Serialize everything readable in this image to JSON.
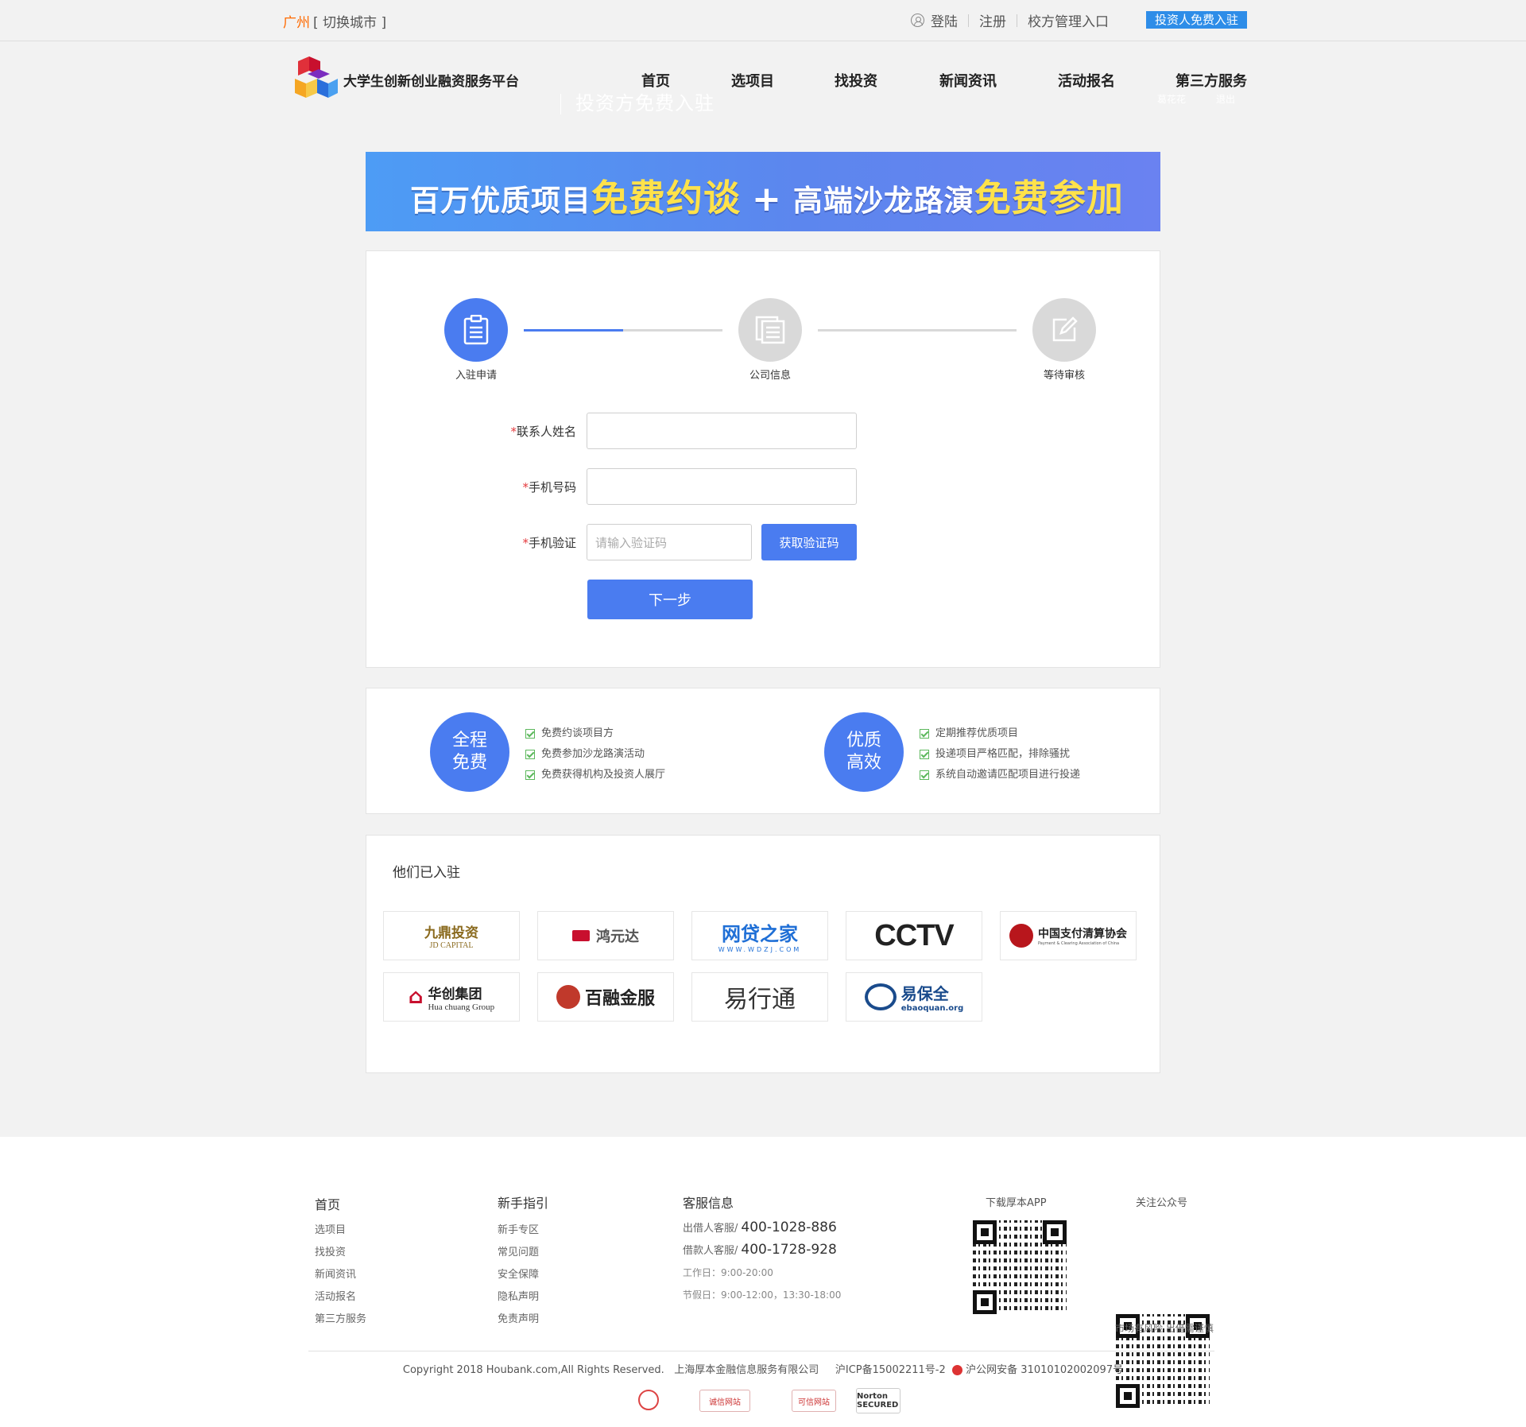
{
  "topbar": {
    "city": "广州",
    "switch_city": "[ 切换城市 ]",
    "login": "登陆",
    "register": "注册",
    "school_entry": "校方管理入口",
    "investor_button": "投资人免费入驻"
  },
  "header": {
    "site_name": "大学生创新创业融资服务平台",
    "ghost_title": "投资方免费入驻",
    "nav": [
      "首页",
      "选项目",
      "找投资",
      "新闻资讯",
      "活动报名",
      "第三方服务"
    ],
    "ghost_links": [
      "葛花花",
      "退出"
    ]
  },
  "banner": {
    "part1": "百万优质项目",
    "highlight1": "免费约谈",
    "plus": "+",
    "part2": "高端沙龙路演",
    "highlight2": "免费参加"
  },
  "steps": [
    {
      "label": "入驻申请",
      "icon": "clipboard-icon"
    },
    {
      "label": "公司信息",
      "icon": "document-icon"
    },
    {
      "label": "等待审核",
      "icon": "edit-icon"
    }
  ],
  "form": {
    "required_mark": "*",
    "name_label": "联系人姓名",
    "name_value": "",
    "phone_label": "手机号码",
    "phone_value": "",
    "code_label": "手机验证",
    "code_placeholder": "请输入验证码",
    "get_code_button": "获取验证码",
    "next_button": "下一步"
  },
  "benefits": [
    {
      "title_line1": "全程",
      "title_line2": "免费",
      "items": [
        "免费约谈项目方",
        "免费参加沙龙路演活动",
        "免费获得机构及投资人展厅"
      ]
    },
    {
      "title_line1": "优质",
      "title_line2": "高效",
      "items": [
        "定期推荐优质项目",
        "投递项目严格匹配，排除骚扰",
        "系统自动邀请匹配项目进行投递"
      ]
    }
  ],
  "partners": {
    "title": "他们已入驻",
    "logos": [
      {
        "name": "九鼎投资",
        "sub": "JD CAPITAL",
        "color": "#8a6a1e"
      },
      {
        "name": "鸿元达",
        "sub": "",
        "color": "#555555"
      },
      {
        "name": "网贷之家",
        "sub": "WWW.WDZJ.COM",
        "color": "#1f6fd6"
      },
      {
        "name": "CCTV",
        "sub": "",
        "color": "#222222"
      },
      {
        "name": "中国支付清算协会",
        "sub": "Payment & Clearing Association of China",
        "color": "#b8161c"
      },
      {
        "name": "华创集团",
        "sub": "Hua chuang Group",
        "color": "#222222"
      },
      {
        "name": "百融金服",
        "sub": "",
        "color": "#222222"
      },
      {
        "name": "易行通",
        "sub": "",
        "color": "#333333"
      },
      {
        "name": "易保全",
        "sub": "ebaoquan.org",
        "color": "#1a4b8c"
      }
    ]
  },
  "footer": {
    "col1_title": "首页",
    "col1_links": [
      "选项目",
      "找投资",
      "新闻资讯",
      "活动报名",
      "第三方服务"
    ],
    "col2_title": "新手指引",
    "col2_links": [
      "新手专区",
      "常见问题",
      "安全保障",
      "隐私声明",
      "免责声明"
    ],
    "col3_title": "客服信息",
    "lender_label": "出借人客服/",
    "lender_phone": "400-1028-886",
    "borrower_label": "借款人客服/",
    "borrower_phone": "400-1728-928",
    "workday": "工作日：9:00-20:00",
    "holiday": "节假日：9:00-12:00，13:30-18:00",
    "app_title": "下载厚本APP",
    "wechat_title": "关注公众号",
    "risk_note": "市场有风险 出借需谨慎",
    "copyright": "Copyright 2018 Houbank.com,All Rights Reserved.",
    "company": "上海厚本金融信息服务有限公司",
    "icp": "沪ICP备15002211号-2",
    "police": "沪公网安备 31010102002097号",
    "badges": [
      "",
      "诚信网站",
      "可信网站",
      "Norton SECURED"
    ]
  },
  "colors": {
    "accent": "#4a7cf0",
    "city": "#ff6a00",
    "investor_button": "#2e8de8"
  }
}
